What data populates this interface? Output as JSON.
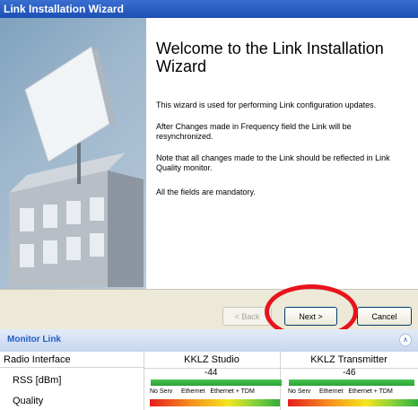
{
  "window": {
    "title": "Link Installation Wizard"
  },
  "wizard": {
    "heading": "Welcome to the Link Installation Wizard",
    "paragraphs": [
      "This wizard is used for performing Link configuration updates.",
      "After Changes made in Frequency field the Link will be resynchronized.",
      "Note that all changes made to the Link should be reflected in Link Quality monitor.",
      "All the fields are mandatory."
    ]
  },
  "buttons": {
    "back": "< Back",
    "next": "Next >",
    "cancel": "Cancel"
  },
  "monitor": {
    "title": "Monitor Link",
    "header": {
      "col0": "Radio Interface",
      "col1": "KKLZ Studio",
      "col2": "KKLZ Transmitter"
    },
    "rss": {
      "label": "RSS [dBm]",
      "studio": "-44",
      "transmitter": "-46"
    },
    "quality": {
      "label": "Quality",
      "scale": [
        "No Serv",
        "Ethernet",
        "Ethernet + TDM"
      ]
    }
  },
  "colors": {
    "title_bar": "#1b4fb4",
    "callout": "#e8131b",
    "monitor_title": "#215dc6"
  }
}
